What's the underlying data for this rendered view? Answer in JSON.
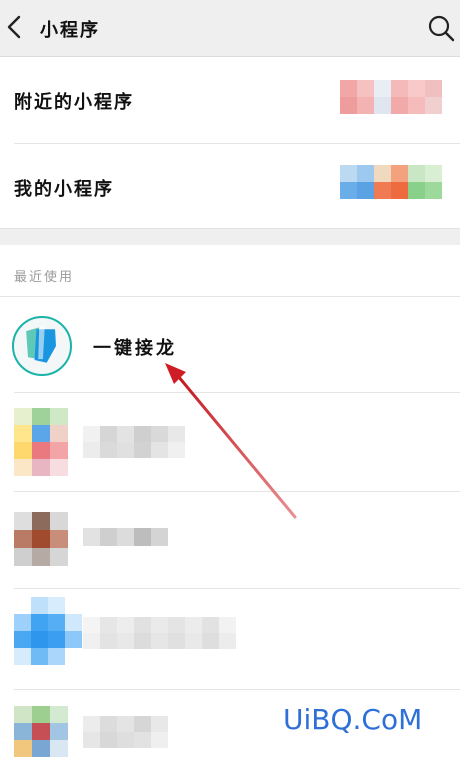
{
  "header": {
    "title": "小程序",
    "back_icon": "chevron-left-icon",
    "search_icon": "search-icon"
  },
  "rows": [
    {
      "label": "附近的小程序"
    },
    {
      "label": "我的小程序"
    }
  ],
  "recent": {
    "section_title": "最近使用",
    "first_app_name": "一键接龙"
  },
  "colors": {
    "header_bg": "#efefef",
    "icon_ring": "#1bb3a9",
    "icon_blue": "#1a96e0",
    "annotation_arrow": "#d9242b",
    "watermark": "#2f70d8"
  },
  "watermark": "UiBQ.CoM"
}
